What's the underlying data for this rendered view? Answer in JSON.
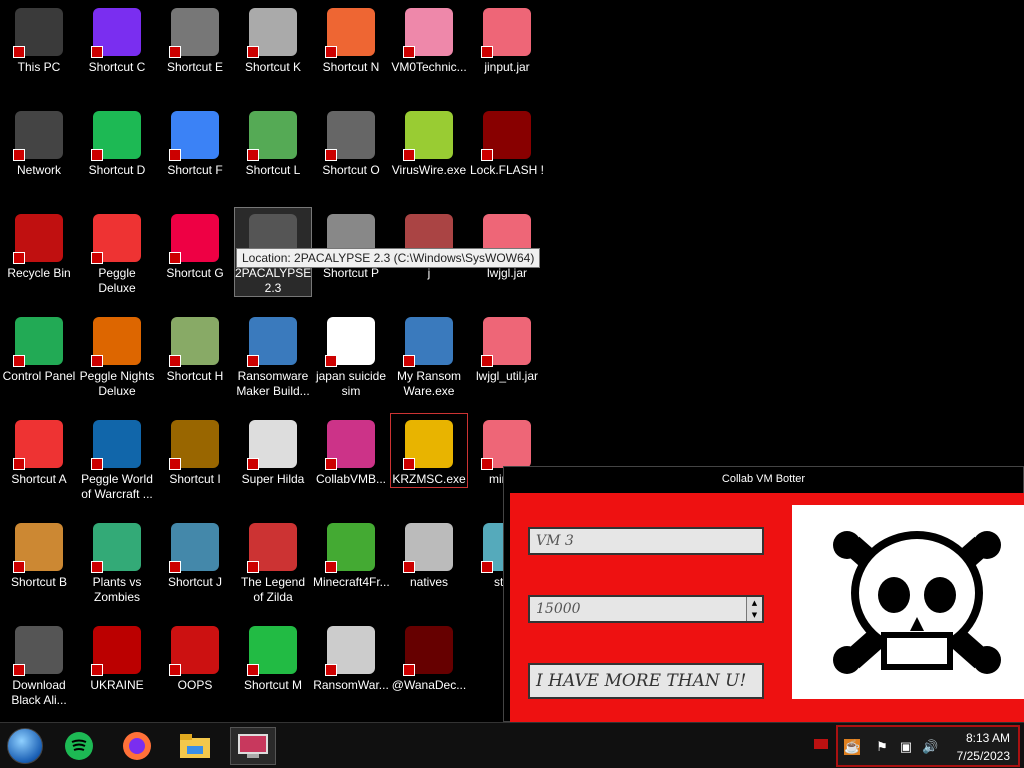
{
  "desktop": {
    "tooltip": "Location: 2PACALYPSE 2.3 (C:\\Windows\\SysWOW64)",
    "icons": [
      {
        "label": "This PC"
      },
      {
        "label": "Network"
      },
      {
        "label": "Recycle Bin"
      },
      {
        "label": "Control Panel"
      },
      {
        "label": "Shortcut A"
      },
      {
        "label": "Shortcut B"
      },
      {
        "label": "Download Black Ali..."
      },
      {
        "label": "Shortcut C"
      },
      {
        "label": "Shortcut D"
      },
      {
        "label": "Peggle Deluxe"
      },
      {
        "label": "Peggle Nights Deluxe"
      },
      {
        "label": "Peggle World of Warcraft ..."
      },
      {
        "label": "Plants vs Zombies"
      },
      {
        "label": "UKRAINE"
      },
      {
        "label": "Shortcut E"
      },
      {
        "label": "Shortcut F"
      },
      {
        "label": "Shortcut G"
      },
      {
        "label": "Shortcut H"
      },
      {
        "label": "Shortcut I"
      },
      {
        "label": "Shortcut J"
      },
      {
        "label": "OOPS"
      },
      {
        "label": "Shortcut K"
      },
      {
        "label": "Shortcut L"
      },
      {
        "label": "2PACALYPSE 2.3"
      },
      {
        "label": "Ransomware Maker Build..."
      },
      {
        "label": "Super Hilda"
      },
      {
        "label": "The Legend of Zilda"
      },
      {
        "label": "Shortcut M"
      },
      {
        "label": "Shortcut N"
      },
      {
        "label": "Shortcut O"
      },
      {
        "label": "Shortcut P"
      },
      {
        "label": "japan suicide sim"
      },
      {
        "label": "CollabVMB..."
      },
      {
        "label": "Minecraft4Fr..."
      },
      {
        "label": "RansomWar..."
      },
      {
        "label": "VM0Technic..."
      },
      {
        "label": "VirusWire.exe"
      },
      {
        "label": "j"
      },
      {
        "label": "My Ransom Ware.exe"
      },
      {
        "label": "KRZMSC.exe"
      },
      {
        "label": "natives"
      },
      {
        "label": "@WanaDec..."
      },
      {
        "label": "jinput.jar"
      },
      {
        "label": "Lock.FLASH !"
      },
      {
        "label": "lwjgl.jar"
      },
      {
        "label": "lwjgl_util.jar"
      },
      {
        "label": "mine..."
      },
      {
        "label": "sta..."
      }
    ]
  },
  "app": {
    "title": "Collab VM Botter",
    "vm_field": "VM 3",
    "number_field": "15000",
    "message_field": "I HAVE MORE THAN U!"
  },
  "taskbar": {
    "time": "8:13 AM",
    "date": "7/25/2023",
    "pinned": [
      {
        "name": "start-button"
      },
      {
        "name": "spotify-icon"
      },
      {
        "name": "firefox-icon"
      },
      {
        "name": "file-explorer-icon"
      },
      {
        "name": "collabvm-app-icon"
      }
    ]
  },
  "colors": {
    "app_body": "#ee1111",
    "tray_border": "#aa1111"
  }
}
